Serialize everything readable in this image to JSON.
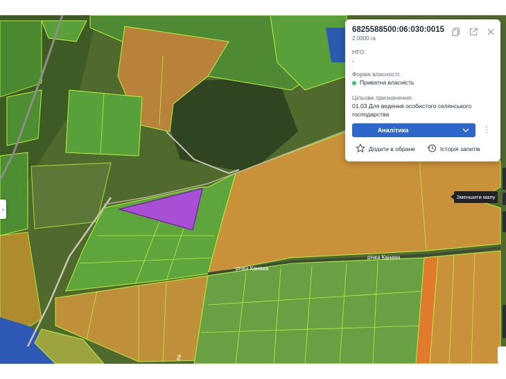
{
  "parcel": {
    "cadastral_number": "6825588500:06:030:0015",
    "area": "2.0000 га",
    "ngo_label": "НГО:",
    "ngo_value": "-",
    "ownership_label": "Форма власності:",
    "ownership_value": "Приватна власність",
    "purpose_label": "Цільове призначення:",
    "purpose_value": "01.03 Для ведення особистого селянського господарства"
  },
  "actions": {
    "analytics_label": "Аналітика",
    "favorite_label": "Додати в обране",
    "history_label": "Історія запитів"
  },
  "map": {
    "tooltip": "Зменшити мапу",
    "river_label_1": "річка Канава",
    "river_label_2": "річка Канава",
    "road_label": "ва"
  },
  "colors": {
    "selected_parcel": "#a84fd6",
    "parcel_outline": "#b9f23a",
    "analytics_button": "#2f66c9",
    "status_dot": "#3cc56a"
  },
  "icons": [
    "copy-icon",
    "open-external-icon",
    "close-icon",
    "chevron-down-icon",
    "more-vertical-icon",
    "star-icon",
    "history-icon",
    "chevron-left-icon"
  ]
}
